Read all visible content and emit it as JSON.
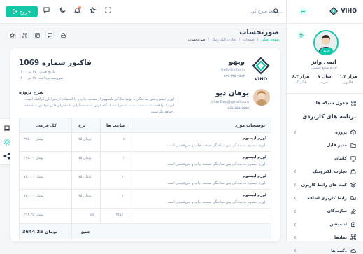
{
  "header": {
    "logout_label": "خروج",
    "search_placeholder": "اینجا سرچ کن ..."
  },
  "sidebar": {
    "logo": "VIHO",
    "user": {
      "name": "ایمی واتز",
      "role": "اداره منابع انسانی",
      "badge": "جدید",
      "stats": [
        {
          "value": "۱.۳ هزار",
          "label": "فالوور"
        },
        {
          "value": "۷ سال",
          "label": "تجربه"
        },
        {
          "value": "۶.۴ هزار",
          "label": "فالوینگ"
        }
      ]
    },
    "grid_item": "جدول شبکه ها",
    "section_title": "برنامه های کاربردی",
    "items": [
      {
        "label": "پروژه",
        "icon": "box-icon",
        "chevron": true
      },
      {
        "label": "مدیر فایل",
        "icon": "folder-icon",
        "chevron": false
      },
      {
        "label": "کانبان",
        "icon": "monitor-icon",
        "chevron": false
      },
      {
        "label": "تجارت الکترونیک",
        "icon": "bag-icon",
        "chevron": true
      },
      {
        "label": "کیت های رابط کاربری",
        "icon": "layers-icon",
        "chevron": true
      },
      {
        "label": "رابط کاربری اضافه",
        "icon": "folder-plus-icon",
        "chevron": true
      },
      {
        "label": "سازندگان",
        "icon": "edit-icon",
        "chevron": true
      },
      {
        "label": "انیمیشن",
        "icon": "cpu-icon",
        "chevron": true
      },
      {
        "label": "نمادها",
        "icon": "command-icon",
        "chevron": true
      },
      {
        "label": "دکمه ها",
        "icon": "cloud-icon",
        "chevron": true
      }
    ]
  },
  "page": {
    "title": "صورتحساب",
    "breadcrumb": [
      "صفحه اصلی",
      "صفحات",
      "تجارت الکترونیک",
      "صورتحساب"
    ]
  },
  "invoice": {
    "title": "فاکتور شماره 1069",
    "date_line": "تاریخ صدور: ۲۷ تیر ۱۴۰۰",
    "due_line": "سررسید پرداخت: ۲۷ تیر ۱۴۰۰",
    "company": {
      "name": "ویهو",
      "email": "hello@viho.in",
      "phone": "۲۸۹-۳۳۵-۹۵۸۳",
      "logo_text": "VIHO"
    },
    "description_title": "شرح پروژه",
    "description_text": "لورم ایپسوم متن ساختگی با تولید سادگی نامفهوم از صنعت چاپ و با استفاده از طراحان گرافیک است. این یک واقعیت ثابت شده است که خواننده با نگاه کردن به صفحه‌آرایی با محتوای قابل خواندن به صفحه خواهد نگریست.",
    "client": {
      "name": "یوهان دیو",
      "email": "JohanDeo@gmail.com",
      "phone": "۵۵۵-۵۵۵-۵۵۵۵"
    },
    "table": {
      "headers": [
        "توضیحات مورد",
        "ساعت ها",
        "نرخ",
        "کل فرعی"
      ],
      "rows": [
        {
          "title": "لورم ایپسوم",
          "desc": "لورم ایپسوم به سادگی متن ساختگی صنعت چاپ و حروفچینی است.",
          "hours": "۵",
          "rate": "۷۵ تومان",
          "subtotal": "۳۷۵.۰۰ تومان"
        },
        {
          "title": "لورم ایپسوم",
          "desc": "لورم ایپسوم به سادگی متن ساختگی صنعت چاپ و حروفچینی است.",
          "hours": "۳",
          "rate": "۷۵ تومان",
          "subtotal": "۲۲۵.۰۰ تومان"
        },
        {
          "title": "لورم ایپسوم",
          "desc": "لورم ایپسوم به سادگی متن ساختگی صنعت چاپ و حروفچینی است.",
          "hours": "۱۰",
          "rate": "۷۵ تومان",
          "subtotal": "۷۵۰.۰۰ تومان"
        },
        {
          "title": "لورم ایپسوم",
          "desc": "لورم ایپسوم به سادگی متن ساختگی صنعت چاپ و حروفچینی است.",
          "hours": "۱۰",
          "rate": "۷۵ تومان",
          "subtotal": "۷۵۰.۰۰ تومان"
        },
        {
          "title": "",
          "desc": "",
          "hours": "MST",
          "rate": "۵%",
          "subtotal": "۲۱۲.۲۵ تومان"
        }
      ],
      "total_label": "جمع",
      "total_value": "3644.25 تومان"
    }
  },
  "colors": {
    "accent": "#13c7a7",
    "text": "#2a3547",
    "muted": "#7c8fac",
    "danger": "#fa896b"
  }
}
